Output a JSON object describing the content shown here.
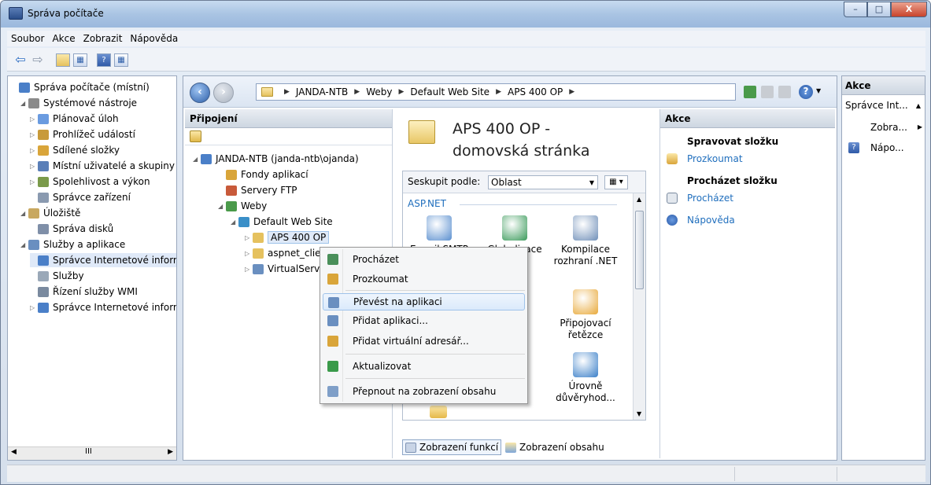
{
  "window": {
    "title": "Správa počítače",
    "min_glyph": "–",
    "max_glyph": "□",
    "close_glyph": "X"
  },
  "menu": {
    "items": [
      "Soubor",
      "Akce",
      "Zobrazit",
      "Nápověda"
    ]
  },
  "left_tree": {
    "items": [
      {
        "label": "Správa počítače (místní)",
        "level": 0,
        "exp": ""
      },
      {
        "label": "Systémové nástroje",
        "level": 1,
        "exp": "◢"
      },
      {
        "label": "Plánovač úloh",
        "level": 2,
        "exp": "▷"
      },
      {
        "label": "Prohlížeč událostí",
        "level": 2,
        "exp": "▷"
      },
      {
        "label": "Sdílené složky",
        "level": 2,
        "exp": "▷"
      },
      {
        "label": "Místní uživatelé a skupiny",
        "level": 2,
        "exp": "▷"
      },
      {
        "label": "Spolehlivost a výkon",
        "level": 2,
        "exp": "▷"
      },
      {
        "label": "Správce zařízení",
        "level": 2,
        "exp": ""
      },
      {
        "label": "Úložiště",
        "level": 1,
        "exp": "◢"
      },
      {
        "label": "Správa disků",
        "level": 2,
        "exp": ""
      },
      {
        "label": "Služby a aplikace",
        "level": 1,
        "exp": "◢"
      },
      {
        "label": "Správce Internetové informační služby",
        "level": 2,
        "exp": "",
        "selected": true
      },
      {
        "label": "Služby",
        "level": 2,
        "exp": ""
      },
      {
        "label": "Řízení služby WMI",
        "level": 2,
        "exp": ""
      },
      {
        "label": "Správce Internetové informační služby",
        "level": 2,
        "exp": "▷"
      }
    ],
    "scroll_label": "III"
  },
  "address": {
    "segments": [
      "JANDA-NTB",
      "Weby",
      "Default Web Site",
      "APS 400 OP"
    ]
  },
  "connections": {
    "title": "Připojení",
    "tree": [
      {
        "label": "JANDA-NTB (janda-ntb\\ojanda)",
        "x": 10,
        "exp": "◢"
      },
      {
        "label": "Fondy aplikací",
        "x": 42,
        "exp": ""
      },
      {
        "label": "Servery FTP",
        "x": 42,
        "exp": ""
      },
      {
        "label": "Weby",
        "x": 42,
        "exp": "◢"
      },
      {
        "label": "Default Web Site",
        "x": 58,
        "exp": "◢"
      },
      {
        "label": "APS 400 OP",
        "x": 76,
        "exp": "▷",
        "selected": true
      },
      {
        "label": "aspnet_client",
        "x": 76,
        "exp": "▷"
      },
      {
        "label": "VirtualServer",
        "x": 76,
        "exp": "▷"
      }
    ]
  },
  "main": {
    "title_line1": "APS 400 OP -",
    "title_line2": "domovská stránka",
    "group_by_label": "Seskupit podle:",
    "group_by_value": "Oblast",
    "group_name": "ASP.NET",
    "features": [
      {
        "label1": "E-mail SMTP",
        "label2": "",
        "color": "#5a8fcf"
      },
      {
        "label1": "Globalizace",
        "label2": ".NET",
        "color": "#3a9a5a"
      },
      {
        "label1": "Kompilace",
        "label2": "rozhraní .NET",
        "color": "#6f8fb8"
      },
      {
        "label1": "Připojovací",
        "label2": "řetězce",
        "color": "#e8a93a"
      },
      {
        "label1": "Úrovně",
        "label2": "důvěryhod...",
        "color": "#3a7fc8"
      }
    ],
    "tab_features": "Zobrazení funkcí",
    "tab_content": "Zobrazení obsahu"
  },
  "actions": {
    "title": "Akce",
    "group1": "Spravovat složku",
    "explore": "Prozkoumat",
    "group2": "Procházet složku",
    "browse": "Procházet",
    "help": "Nápověda"
  },
  "right_pane": {
    "title": "Akce",
    "item1": "Správce Int...",
    "item2": "Zobra...",
    "item3": "Nápo..."
  },
  "context_menu": {
    "items": [
      {
        "label": "Procházet",
        "color": "#4a8f5a"
      },
      {
        "label": "Prozkoumat",
        "color": "#d9a53a"
      },
      {
        "label": "Převést na aplikaci",
        "color": "#6a8fc0",
        "highlight": true
      },
      {
        "label": "Přidat aplikaci...",
        "color": "#6a8fc0"
      },
      {
        "label": "Přidat virtuální adresář...",
        "color": "#d9a53a"
      },
      {
        "label": "Aktualizovat",
        "color": "#3a9a4a"
      },
      {
        "label": "Přepnout na zobrazení obsahu",
        "color": "#7f9fc8"
      }
    ]
  },
  "colors": {
    "link": "#1f6ebd",
    "header_bg": "#cdd6e1",
    "selection": "#dfe9f8"
  }
}
